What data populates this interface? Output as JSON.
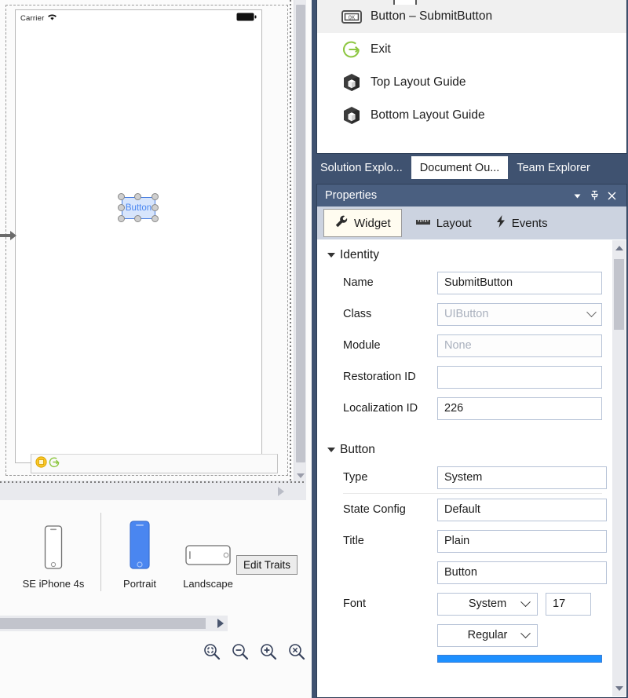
{
  "designer": {
    "status_bar": {
      "carrier": "Carrier",
      "wifi_icon": "wifi-icon",
      "battery_icon": "battery-icon"
    },
    "selected_widget": {
      "label": "Button"
    },
    "scene_dock": {
      "vc_icon": "view-controller-icon",
      "exit_icon": "exit-segue-icon"
    },
    "entry_arrow_icon": "storyboard-entry-point-arrow-icon",
    "device_bar": {
      "size_label": "SE",
      "device": {
        "label": "iPhone 4s",
        "icon": "iphone-portrait-icon"
      },
      "orientations": [
        {
          "label": "Portrait",
          "icon": "phone-portrait-icon",
          "selected": true
        },
        {
          "label": "Landscape",
          "icon": "phone-landscape-icon",
          "selected": false
        }
      ],
      "edit_traits_label": "Edit Traits"
    },
    "zoom_controls": [
      {
        "name": "zoom-to-fit-icon"
      },
      {
        "name": "zoom-out-icon"
      },
      {
        "name": "zoom-in-icon"
      },
      {
        "name": "zoom-actual-size-icon"
      }
    ]
  },
  "outline": {
    "rows": [
      {
        "label": "Button  –  SubmitButton",
        "icon": "button-ok-icon",
        "selected": true
      },
      {
        "label": "Exit",
        "icon": "exit-circle-arrow-icon",
        "selected": false
      },
      {
        "label": "Top Layout Guide",
        "icon": "layout-guide-cube-icon",
        "selected": false
      },
      {
        "label": "Bottom Layout Guide",
        "icon": "layout-guide-cube-icon",
        "selected": false
      }
    ]
  },
  "window_tabs": [
    {
      "label": "Solution Explo...",
      "active": false
    },
    {
      "label": "Document Ou...",
      "active": true
    },
    {
      "label": "Team Explorer",
      "active": false
    }
  ],
  "properties": {
    "title": "Properties",
    "title_buttons": [
      {
        "name": "window-menu-dropdown-icon",
        "glyph": "▾"
      },
      {
        "name": "pin-icon",
        "glyph": "☩"
      },
      {
        "name": "close-icon",
        "glyph": "✕"
      }
    ],
    "tabs": [
      {
        "label": "Widget",
        "icon": "wrench-icon",
        "active": true
      },
      {
        "label": "Layout",
        "icon": "ruler-icon",
        "active": false
      },
      {
        "label": "Events",
        "icon": "lightning-bolt-icon",
        "active": false
      }
    ],
    "sections": [
      {
        "title": "Identity",
        "fields": [
          {
            "label": "Name",
            "value": "SubmitButton",
            "kind": "text",
            "dim": false
          },
          {
            "label": "Class",
            "value": "UIButton",
            "kind": "combo",
            "dim": true
          },
          {
            "label": "Module",
            "value": "None",
            "kind": "text",
            "dim": true
          },
          {
            "label": "Restoration ID",
            "value": "",
            "kind": "text",
            "dim": false
          },
          {
            "label": "Localization ID",
            "value": "226",
            "kind": "text",
            "dim": false
          }
        ]
      },
      {
        "title": "Button",
        "fields": [
          {
            "label": "Type",
            "value": "System",
            "kind": "combo-clipped",
            "dim": false
          },
          {
            "label": "State Config",
            "value": "Default",
            "kind": "combo-clipped",
            "dim": false
          },
          {
            "label": "Title",
            "value": "Plain",
            "kind": "combo-clipped",
            "dim": false
          },
          {
            "label": "",
            "value": "Button",
            "kind": "text-clipped",
            "dim": false
          }
        ],
        "font": {
          "label": "Font",
          "family": "System",
          "size": "17",
          "weight": "Regular"
        },
        "color_swatch": "#1e90ff"
      }
    ]
  }
}
